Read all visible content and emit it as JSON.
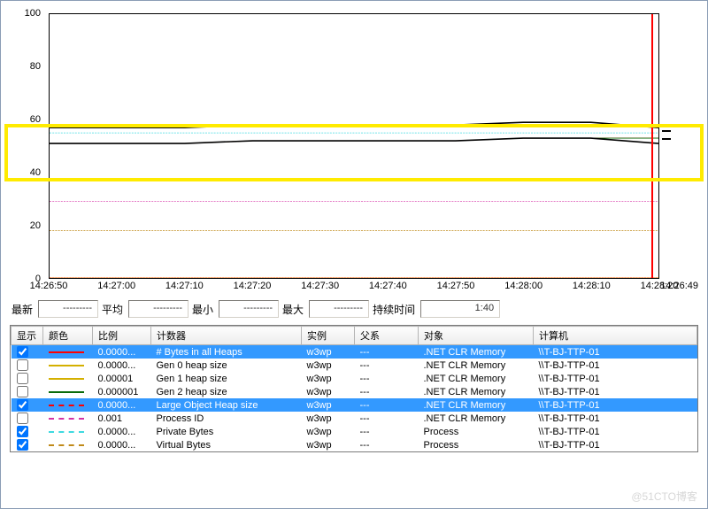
{
  "chart_data": {
    "type": "line",
    "title": "",
    "xlabel": "",
    "ylabel": "",
    "ylim": [
      0,
      100
    ],
    "y_ticks": [
      0,
      20,
      40,
      60,
      80,
      100
    ],
    "x_ticks": [
      "14:26:50",
      "14:27:00",
      "14:27:10",
      "14:27:20",
      "14:27:30",
      "14:27:40",
      "14:27:50",
      "14:28:00",
      "14:28:10",
      "14:28:20"
    ],
    "x_current": "14:26:49",
    "series": [
      {
        "name": "# Bytes in all Heaps",
        "values": [
          51,
          51,
          51,
          52,
          52,
          52,
          52,
          53,
          53,
          53
        ],
        "color": "#ff0000",
        "style": "solid"
      },
      {
        "name": "Gen 0 heap size",
        "values": [
          0,
          0,
          0,
          0,
          0,
          0,
          0,
          0,
          0,
          0
        ],
        "color": "#d4b000",
        "style": "solid"
      },
      {
        "name": "Gen 1 heap size",
        "values": [
          0,
          0,
          0,
          0,
          0,
          0,
          0,
          0,
          0,
          0
        ],
        "color": "#d4b000",
        "style": "solid"
      },
      {
        "name": "Gen 2 heap size",
        "values": [
          51,
          51,
          51,
          52,
          52,
          52,
          52,
          53,
          53,
          53
        ],
        "color": "#0a6b0a",
        "style": "solid"
      },
      {
        "name": "Large Object Heap size",
        "values": [
          0,
          0,
          0,
          0,
          0,
          0,
          0,
          0,
          0,
          0
        ],
        "color": "#ff0000",
        "style": "dashed"
      },
      {
        "name": "Process ID",
        "values": [
          29,
          29,
          29,
          29,
          29,
          29,
          29,
          29,
          29,
          29
        ],
        "color": "#d633a6",
        "style": "dashed"
      },
      {
        "name": "Private Bytes",
        "values": [
          55,
          55,
          55,
          55,
          55,
          55,
          55,
          55,
          55,
          55
        ],
        "color": "#3fd9e0",
        "style": "dashed"
      },
      {
        "name": "Virtual Bytes",
        "values": [
          18,
          18,
          18,
          18,
          18,
          18,
          18,
          18,
          18,
          18
        ],
        "color": "#c08a1a",
        "style": "dashed"
      }
    ]
  },
  "stats": {
    "labels": {
      "latest": "最新",
      "avg": "平均",
      "min": "最小",
      "max": "最大",
      "duration": "持续时间"
    },
    "values": {
      "latest": "---------",
      "avg": "---------",
      "min": "---------",
      "max": "---------",
      "duration": "1:40"
    }
  },
  "columns": {
    "show": "显示",
    "color": "颜色",
    "scale": "比例",
    "counter": "计数器",
    "instance": "实例",
    "parent": "父系",
    "object": "对象",
    "computer": "计算机"
  },
  "counters": [
    {
      "show": true,
      "color": "#ff0000",
      "style": "solid",
      "scale": "0.0000...",
      "name": "# Bytes in all Heaps",
      "instance": "w3wp",
      "parent": "---",
      "object": ".NET CLR Memory",
      "computer": "\\\\T-BJ-TTP-01",
      "selected": true
    },
    {
      "show": false,
      "color": "#d4b000",
      "style": "solid",
      "scale": "0.0000...",
      "name": "Gen 0 heap size",
      "instance": "w3wp",
      "parent": "---",
      "object": ".NET CLR Memory",
      "computer": "\\\\T-BJ-TTP-01",
      "selected": false
    },
    {
      "show": false,
      "color": "#d4b000",
      "style": "solid",
      "scale": "0.00001",
      "name": "Gen 1 heap size",
      "instance": "w3wp",
      "parent": "---",
      "object": ".NET CLR Memory",
      "computer": "\\\\T-BJ-TTP-01",
      "selected": false
    },
    {
      "show": false,
      "color": "#0a6b0a",
      "style": "solid",
      "scale": "0.000001",
      "name": "Gen 2 heap size",
      "instance": "w3wp",
      "parent": "---",
      "object": ".NET CLR Memory",
      "computer": "\\\\T-BJ-TTP-01",
      "selected": false
    },
    {
      "show": true,
      "color": "#ff0000",
      "style": "dashed",
      "scale": "0.0000...",
      "name": "Large Object Heap size",
      "instance": "w3wp",
      "parent": "---",
      "object": ".NET CLR Memory",
      "computer": "\\\\T-BJ-TTP-01",
      "selected": true
    },
    {
      "show": false,
      "color": "#d633a6",
      "style": "dashed",
      "scale": "0.001",
      "name": "Process ID",
      "instance": "w3wp",
      "parent": "---",
      "object": ".NET CLR Memory",
      "computer": "\\\\T-BJ-TTP-01",
      "selected": false
    },
    {
      "show": true,
      "color": "#3fd9e0",
      "style": "dashed",
      "scale": "0.0000...",
      "name": "Private Bytes",
      "instance": "w3wp",
      "parent": "---",
      "object": "Process",
      "computer": "\\\\T-BJ-TTP-01",
      "selected": false
    },
    {
      "show": true,
      "color": "#c08a1a",
      "style": "dashed",
      "scale": "0.0000...",
      "name": "Virtual Bytes",
      "instance": "w3wp",
      "parent": "---",
      "object": "Process",
      "computer": "\\\\T-BJ-TTP-01",
      "selected": false
    }
  ],
  "watermark": "@51CTO博客"
}
